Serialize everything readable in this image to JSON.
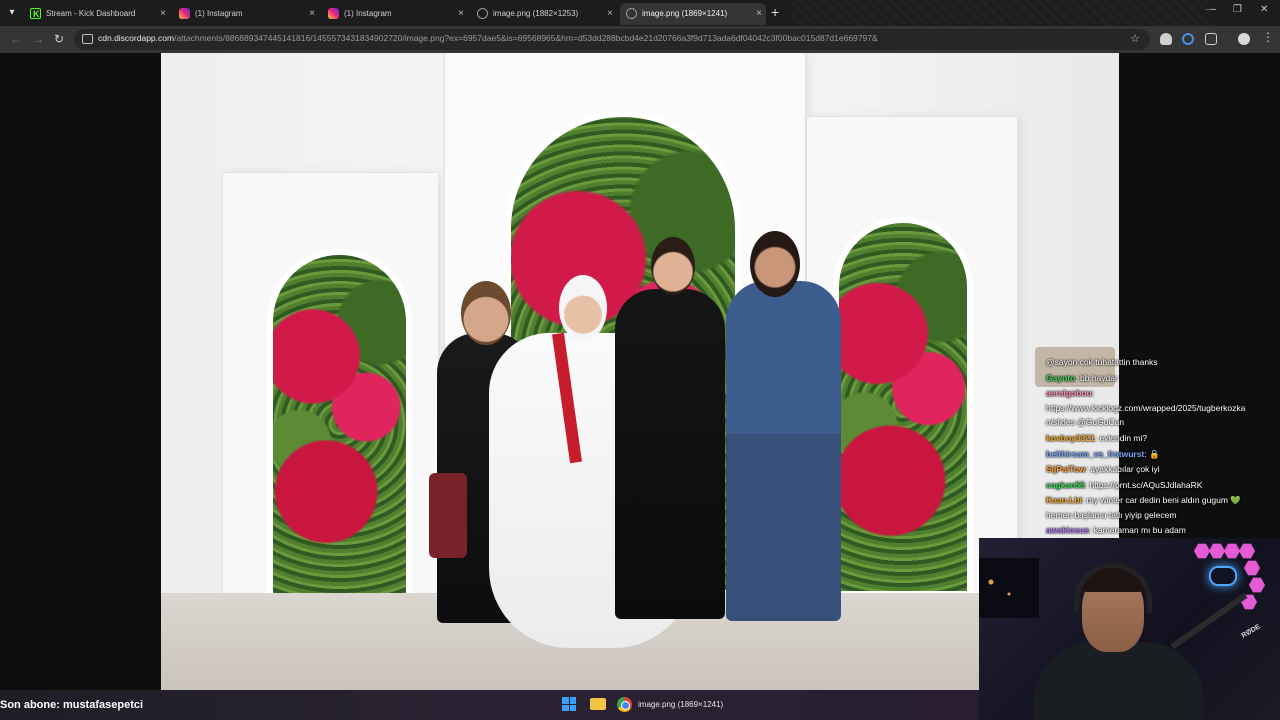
{
  "browser": {
    "tabs": [
      {
        "title": "Stream - Kick Dashboard",
        "icon": "kick-icon",
        "active": false
      },
      {
        "title": "(1) Instagram",
        "icon": "instagram-icon",
        "active": false
      },
      {
        "title": "(1) Instagram",
        "icon": "instagram-icon",
        "active": false
      },
      {
        "title": "image.png (1882×1253)",
        "icon": "globe-icon",
        "active": false
      },
      {
        "title": "image.png (1869×1241)",
        "icon": "globe-icon",
        "active": true
      }
    ],
    "new_tab": "+",
    "close": "×",
    "url_host": "cdn.discordapp.com",
    "url_path": "/attachments/886889347445141816/1455573431834902720/image.png?ex=6957dae5&is=6956896​5&hm=d53dd288bcbd4e21d20766a3f9d713ada6df04042c3f00bac015d87d1e669797&"
  },
  "chat": {
    "messages": [
      {
        "user": "",
        "text": "@sayon cok tuhatattin thanks",
        "color": "#ffffff"
      },
      {
        "user": "Gaynto",
        "text": ": bb haydar",
        "color": "#39d353"
      },
      {
        "user": "aeralgobou",
        "text": ":",
        "color": "#ff8fb1"
      },
      {
        "user": "",
        "text": "https://www.kicklogz.com/wrapped/2025/tugberkozka",
        "color": "#ffffff"
      },
      {
        "user": "",
        "text": "n/slides @GuGuCan",
        "color": "#ffffff"
      },
      {
        "user": "kovboy3321",
        "text": ": evlendin mi?",
        "color": "#f5a623"
      },
      {
        "user": "belthirsam_vs_fratwurst",
        "text": ": 🔒",
        "color": "#7aa7ff"
      },
      {
        "user": "SijPaiTow",
        "text": ": ayakkabılar çok iyi",
        "color": "#ff9d3b"
      },
      {
        "user": "cagkan55",
        "text": ": https://prnt.sc/AQuSJdlahaRK",
        "color": "#39d353"
      },
      {
        "user": "Kaan.Lbi",
        "text": ": my winter car dedin beni aldın gugum 💚",
        "color": "#f5a623"
      },
      {
        "user": "",
        "text": "hemen başlama tatlı yiyip gelecem",
        "color": "#ffffff"
      },
      {
        "user": "awakiosus",
        "text": ": kameraman mı bu adam",
        "color": "#b57bff"
      }
    ]
  },
  "webcam": {
    "brand": "RØDE"
  },
  "subscriber": {
    "text": "Son abone: mustafasepetci"
  },
  "taskbar": {
    "active_window": "image.png (1869×1241)"
  }
}
